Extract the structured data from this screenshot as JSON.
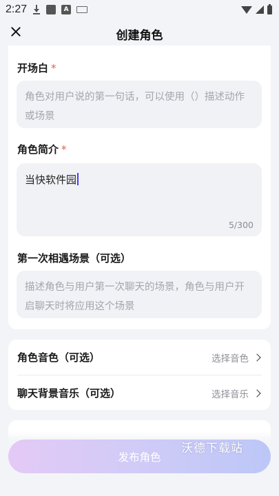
{
  "status_bar": {
    "time": "2:27"
  },
  "nav": {
    "title": "创建角色"
  },
  "opening_line": {
    "label": "开场白",
    "required_mark": "*",
    "placeholder": "角色对用户说的第一句话，可以使用（）描述动作或场景"
  },
  "intro": {
    "label": "角色简介",
    "required_mark": "*",
    "value": "当快软件园",
    "counter": "5/300"
  },
  "first_scene": {
    "label": "第一次相遇场景（可选）",
    "placeholder": "描述角色与用户第一次聊天的场景，角色与用户开启聊天时将应用这个场景"
  },
  "options": [
    {
      "label": "角色音色（可选）",
      "value": "选择音色"
    },
    {
      "label": "聊天背景音乐（可选）",
      "value": "选择音乐"
    }
  ],
  "third_section": {
    "label": ""
  },
  "publish_button": {
    "label": "发布角色"
  },
  "watermark": {
    "text": "沃德下载站"
  },
  "colors": {
    "required": "#f05a4a",
    "caret": "#4a3cf5",
    "button_start": "#e4c9f6",
    "button_end": "#bcc7f7"
  }
}
